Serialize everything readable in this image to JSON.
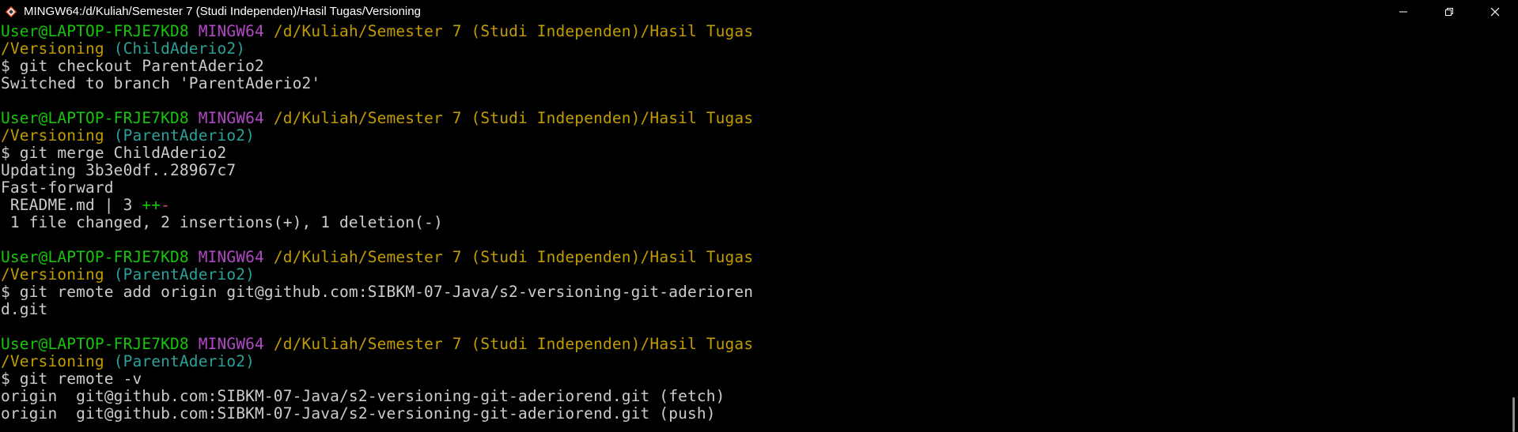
{
  "window": {
    "title": "MINGW64:/d/Kuliah/Semester 7 (Studi Independen)/Hasil Tugas/Versioning",
    "icon": "git-bash-icon"
  },
  "colors": {
    "user": "#16c60c",
    "mingw": "#b148c6",
    "path": "#c19c00",
    "branch": "#2aa198",
    "text": "#cccccc"
  },
  "terminal": {
    "prompt_user": "User@LAPTOP-FRJE7KD8",
    "prompt_env": "MINGW64",
    "prompt_path": "/d/Kuliah/Semester 7 (Studi Independen)/Hasil Tugas",
    "prompt_path_cont": "/Versioning",
    "blocks": [
      {
        "branch": "(ChildAderio2)",
        "command": "$ git checkout ParentAderio2",
        "output": [
          "Switched to branch 'ParentAderio2'"
        ]
      },
      {
        "branch": "(ParentAderio2)",
        "command": "$ git merge ChildAderio2",
        "output": [
          "Updating 3b3e0df..28967c7",
          "Fast-forward"
        ],
        "diffstat_file": " README.md | 3 ",
        "diffstat_add": "++",
        "diffstat_del": "-",
        "summary": " 1 file changed, 2 insertions(+), 1 deletion(-)"
      },
      {
        "branch": "(ParentAderio2)",
        "command": "$ git remote add origin git@github.com:SIBKM-07-Java/s2-versioning-git-aderioren",
        "command_cont": "d.git"
      },
      {
        "branch": "(ParentAderio2)",
        "command": "$ git remote -v",
        "output": [
          "origin  git@github.com:SIBKM-07-Java/s2-versioning-git-aderiorend.git (fetch)",
          "origin  git@github.com:SIBKM-07-Java/s2-versioning-git-aderiorend.git (push)"
        ]
      }
    ]
  }
}
